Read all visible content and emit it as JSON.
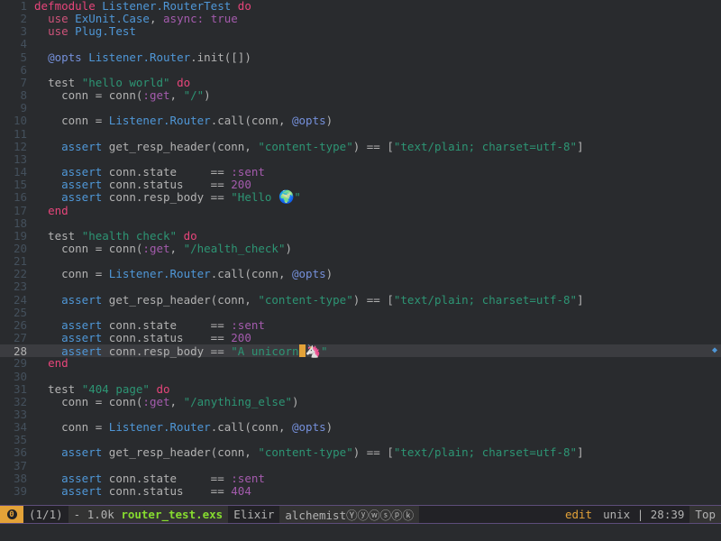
{
  "lines": [
    {
      "n": "1",
      "tokens": [
        [
          "kw",
          "defmodule"
        ],
        [
          "plain",
          " "
        ],
        [
          "mod",
          "Listener.RouterTest"
        ],
        [
          "plain",
          " "
        ],
        [
          "kw",
          "do"
        ]
      ]
    },
    {
      "n": "2",
      "tokens": [
        [
          "plain",
          "  "
        ],
        [
          "kw2",
          "use"
        ],
        [
          "plain",
          " "
        ],
        [
          "mod",
          "ExUnit.Case"
        ],
        [
          "plain",
          ", "
        ],
        [
          "atom",
          "async:"
        ],
        [
          "plain",
          " "
        ],
        [
          "atom",
          "true"
        ]
      ]
    },
    {
      "n": "3",
      "tokens": [
        [
          "plain",
          "  "
        ],
        [
          "kw2",
          "use"
        ],
        [
          "plain",
          " "
        ],
        [
          "mod",
          "Plug.Test"
        ]
      ]
    },
    {
      "n": "4",
      "tokens": []
    },
    {
      "n": "5",
      "tokens": [
        [
          "plain",
          "  "
        ],
        [
          "attr",
          "@opts"
        ],
        [
          "plain",
          " "
        ],
        [
          "mod",
          "Listener.Router"
        ],
        [
          "plain",
          ".init([])"
        ]
      ]
    },
    {
      "n": "6",
      "tokens": []
    },
    {
      "n": "7",
      "tokens": [
        [
          "plain",
          "  "
        ],
        [
          "plain",
          "test "
        ],
        [
          "str",
          "\"hello world\""
        ],
        [
          "plain",
          " "
        ],
        [
          "kw",
          "do"
        ]
      ]
    },
    {
      "n": "8",
      "tokens": [
        [
          "plain",
          "    conn = conn("
        ],
        [
          "atom",
          ":get"
        ],
        [
          "plain",
          ", "
        ],
        [
          "str",
          "\"/\""
        ],
        [
          "plain",
          ")"
        ]
      ]
    },
    {
      "n": "9",
      "tokens": []
    },
    {
      "n": "10",
      "tokens": [
        [
          "plain",
          "    conn = "
        ],
        [
          "mod",
          "Listener.Router"
        ],
        [
          "plain",
          ".call(conn, "
        ],
        [
          "attr",
          "@opts"
        ],
        [
          "plain",
          ")"
        ]
      ]
    },
    {
      "n": "11",
      "tokens": []
    },
    {
      "n": "12",
      "tokens": [
        [
          "plain",
          "    "
        ],
        [
          "mod",
          "assert"
        ],
        [
          "plain",
          " get_resp_header(conn, "
        ],
        [
          "str",
          "\"content-type\""
        ],
        [
          "plain",
          ") == ["
        ],
        [
          "str",
          "\"text/plain; charset=utf-8\""
        ],
        [
          "plain",
          "]"
        ]
      ]
    },
    {
      "n": "13",
      "tokens": []
    },
    {
      "n": "14",
      "tokens": [
        [
          "plain",
          "    "
        ],
        [
          "mod",
          "assert"
        ],
        [
          "plain",
          " conn.state     == "
        ],
        [
          "atom",
          ":sent"
        ]
      ]
    },
    {
      "n": "15",
      "tokens": [
        [
          "plain",
          "    "
        ],
        [
          "mod",
          "assert"
        ],
        [
          "plain",
          " conn.status    == "
        ],
        [
          "num",
          "200"
        ]
      ]
    },
    {
      "n": "16",
      "tokens": [
        [
          "plain",
          "    "
        ],
        [
          "mod",
          "assert"
        ],
        [
          "plain",
          " conn.resp_body == "
        ],
        [
          "str",
          "\"Hello "
        ],
        [
          "emoji",
          "🌍"
        ],
        [
          "str",
          "\""
        ]
      ]
    },
    {
      "n": "17",
      "tokens": [
        [
          "plain",
          "  "
        ],
        [
          "kw",
          "end"
        ]
      ]
    },
    {
      "n": "18",
      "tokens": []
    },
    {
      "n": "19",
      "tokens": [
        [
          "plain",
          "  test "
        ],
        [
          "str",
          "\"health check\""
        ],
        [
          "plain",
          " "
        ],
        [
          "kw",
          "do"
        ]
      ]
    },
    {
      "n": "20",
      "tokens": [
        [
          "plain",
          "    conn = conn("
        ],
        [
          "atom",
          ":get"
        ],
        [
          "plain",
          ", "
        ],
        [
          "str",
          "\"/health_check\""
        ],
        [
          "plain",
          ")"
        ]
      ]
    },
    {
      "n": "21",
      "tokens": []
    },
    {
      "n": "22",
      "tokens": [
        [
          "plain",
          "    conn = "
        ],
        [
          "mod",
          "Listener.Router"
        ],
        [
          "plain",
          ".call(conn, "
        ],
        [
          "attr",
          "@opts"
        ],
        [
          "plain",
          ")"
        ]
      ]
    },
    {
      "n": "23",
      "tokens": []
    },
    {
      "n": "24",
      "tokens": [
        [
          "plain",
          "    "
        ],
        [
          "mod",
          "assert"
        ],
        [
          "plain",
          " get_resp_header(conn, "
        ],
        [
          "str",
          "\"content-type\""
        ],
        [
          "plain",
          ") == ["
        ],
        [
          "str",
          "\"text/plain; charset=utf-8\""
        ],
        [
          "plain",
          "]"
        ]
      ]
    },
    {
      "n": "25",
      "tokens": []
    },
    {
      "n": "26",
      "tokens": [
        [
          "plain",
          "    "
        ],
        [
          "mod",
          "assert"
        ],
        [
          "plain",
          " conn.state     == "
        ],
        [
          "atom",
          ":sent"
        ]
      ]
    },
    {
      "n": "27",
      "tokens": [
        [
          "plain",
          "    "
        ],
        [
          "mod",
          "assert"
        ],
        [
          "plain",
          " conn.status    == "
        ],
        [
          "num",
          "200"
        ]
      ]
    },
    {
      "n": "28",
      "current": true,
      "tokens": [
        [
          "plain",
          "    "
        ],
        [
          "mod",
          "assert"
        ],
        [
          "plain",
          " conn.resp_body == "
        ],
        [
          "str",
          "\"A unicorn"
        ],
        [
          "cursor",
          ""
        ],
        [
          "emoji",
          "🦄"
        ],
        [
          "str",
          "\""
        ]
      ]
    },
    {
      "n": "29",
      "tokens": [
        [
          "plain",
          "  "
        ],
        [
          "kw",
          "end"
        ]
      ]
    },
    {
      "n": "30",
      "tokens": []
    },
    {
      "n": "31",
      "tokens": [
        [
          "plain",
          "  test "
        ],
        [
          "str",
          "\"404 page\""
        ],
        [
          "plain",
          " "
        ],
        [
          "kw",
          "do"
        ]
      ]
    },
    {
      "n": "32",
      "tokens": [
        [
          "plain",
          "    conn = conn("
        ],
        [
          "atom",
          ":get"
        ],
        [
          "plain",
          ", "
        ],
        [
          "str",
          "\"/anything_else\""
        ],
        [
          "plain",
          ")"
        ]
      ]
    },
    {
      "n": "33",
      "tokens": []
    },
    {
      "n": "34",
      "tokens": [
        [
          "plain",
          "    conn = "
        ],
        [
          "mod",
          "Listener.Router"
        ],
        [
          "plain",
          ".call(conn, "
        ],
        [
          "attr",
          "@opts"
        ],
        [
          "plain",
          ")"
        ]
      ]
    },
    {
      "n": "35",
      "tokens": []
    },
    {
      "n": "36",
      "tokens": [
        [
          "plain",
          "    "
        ],
        [
          "mod",
          "assert"
        ],
        [
          "plain",
          " get_resp_header(conn, "
        ],
        [
          "str",
          "\"content-type\""
        ],
        [
          "plain",
          ") == ["
        ],
        [
          "str",
          "\"text/plain; charset=utf-8\""
        ],
        [
          "plain",
          "]"
        ]
      ]
    },
    {
      "n": "37",
      "tokens": []
    },
    {
      "n": "38",
      "tokens": [
        [
          "plain",
          "    "
        ],
        [
          "mod",
          "assert"
        ],
        [
          "plain",
          " conn.state     == "
        ],
        [
          "atom",
          ":sent"
        ]
      ]
    },
    {
      "n": "39",
      "tokens": [
        [
          "plain",
          "    "
        ],
        [
          "mod",
          "assert"
        ],
        [
          "plain",
          " conn.status    == "
        ],
        [
          "num",
          "404"
        ]
      ]
    }
  ],
  "modeline": {
    "badge": "0",
    "window_count": "(1/1)",
    "size": "- 1.0k",
    "filename": "router_test.exs",
    "major_mode": "Elixir",
    "minor_modes": "alchemistⓎⓨⓦⓢⓟⓚ",
    "state": "edit",
    "encoding": "unix",
    "position": "28:39",
    "scroll": "Top"
  },
  "colors": {
    "background": "#292b2e",
    "modeline_bg": "#222226",
    "accent_orange": "#e3a238",
    "filename_green": "#86dc2f",
    "keyword_pink": "#e6457a",
    "module_blue": "#4f97d7",
    "string_green": "#2d9574",
    "atom_purple": "#a45bad"
  }
}
